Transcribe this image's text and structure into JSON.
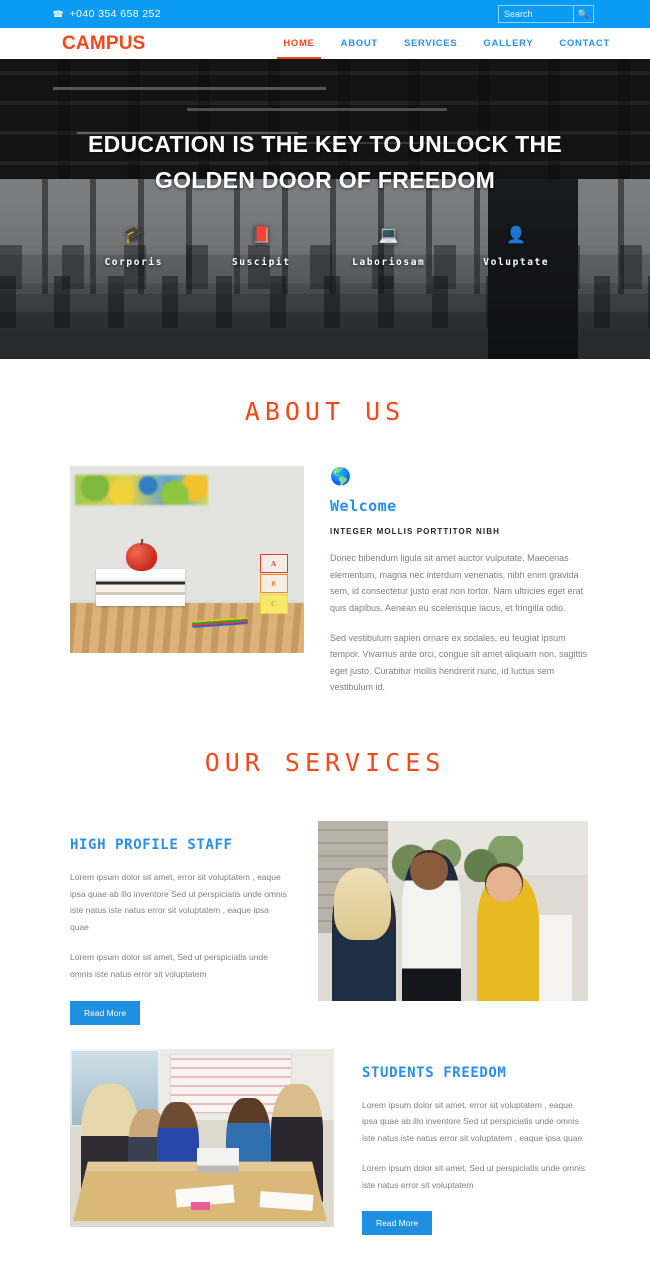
{
  "topbar": {
    "phone_icon": "phone-icon",
    "phone": "+040 354 658 252",
    "search_placeholder": "Search",
    "search_value": "",
    "search_icon": "search-icon"
  },
  "header": {
    "logo": "CAMPUS",
    "nav": [
      {
        "label": "HOME",
        "active": true
      },
      {
        "label": "ABOUT",
        "active": false
      },
      {
        "label": "SERVICES",
        "active": false
      },
      {
        "label": "GALLERY",
        "active": false
      },
      {
        "label": "CONTACT",
        "active": false
      }
    ]
  },
  "hero": {
    "title": "EDUCATION IS THE KEY TO UNLOCK THE GOLDEN DOOR OF FREEDOM",
    "features": [
      {
        "icon": "graduation-cap-icon",
        "glyph": "🎓",
        "label": "Corporis"
      },
      {
        "icon": "book-icon",
        "glyph": "📕",
        "label": "Suscipit"
      },
      {
        "icon": "laptop-icon",
        "glyph": "💻",
        "label": "Laboriosam"
      },
      {
        "icon": "user-icon",
        "glyph": "👤",
        "label": "Voluptate"
      }
    ]
  },
  "about": {
    "heading": "ABOUT US",
    "image_alt": "classroom-desk-apple-books-photo",
    "globe_icon": "globe-icon",
    "globe_glyph": "🌎",
    "title": "Welcome",
    "subtitle": "INTEGER MOLLIS PORTTITOR NIBH",
    "paragraphs": [
      "Donec bibendum ligula sit amet auctor vulputate. Maecenas elementum, magna nec interdum venenatis, nibh enim gravida sem, id consectetur justo erat non tortor. Nam ultricies eget erat quis dapibus. Aenean eu scelerisque lacus, et fringilla odio.",
      "Sed vestibulum sapien ornare ex sodales, eu feugiat ipsum tempor. Vivamus ante orci, congue sit amet aliquam non, sagittis eget justo. Curabitur mollis hendrerit nunc, id luctus sem vestibulum id."
    ],
    "blocks": [
      "A",
      "B",
      "C"
    ]
  },
  "services": {
    "heading": "OUR SERVICES",
    "items": [
      {
        "title": "HIGH PROFILE STAFF",
        "paragraphs": [
          "Lorem ipsum dolor sit amet, error sit voluptatem , eaque ipsa quae ab illo inventore Sed ut perspiciatis unde omnis iste natus iste natus error sit voluptatem , eaque ipsa quae",
          "Lorem ipsum dolor sit amet, Sed ut perspiciatis unde omnis iste natus error sit voluptatem"
        ],
        "button": "Read More",
        "image_alt": "three-students-outdoors-photo"
      },
      {
        "title": "STUDENTS FREEDOM",
        "paragraphs": [
          "Lorem ipsum dolor sit amet, error sit voluptatem , eaque ipsa quae ab illo inventore Sed ut perspiciatis unde omnis iste natus iste natus error sit voluptatem , eaque ipsa quae",
          "Lorem ipsum dolor sit amet, Sed ut perspiciatis unde omnis iste natus error sit voluptatem"
        ],
        "button": "Read More",
        "image_alt": "students-group-table-photo"
      }
    ]
  },
  "colors": {
    "brand_orange": "#f2481b",
    "brand_blue": "#2a8fe8",
    "topbar_blue": "#0b9bf5",
    "button_blue": "#1f8fe0",
    "body_text": "#7b8189"
  }
}
